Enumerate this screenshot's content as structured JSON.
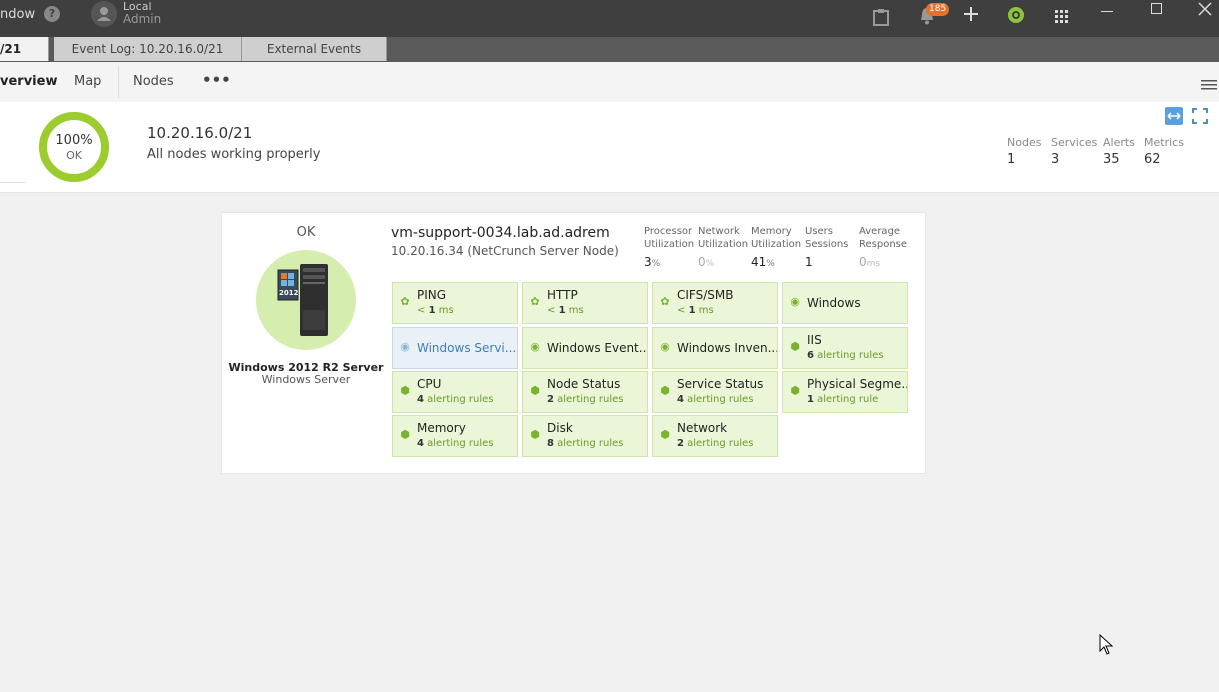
{
  "topbar": {
    "window_fragment": "ndow",
    "user_line1": "Local",
    "user_line2": "Admin",
    "notification_count": "185"
  },
  "tabs": [
    {
      "label": "/21"
    },
    {
      "label": "Event Log: 10.20.16.0/21"
    },
    {
      "label": "External Events"
    }
  ],
  "subnav": {
    "items": [
      "verview",
      "Map",
      "Nodes"
    ],
    "more": "•••"
  },
  "summary": {
    "percent": "100%",
    "percent_value": 100,
    "state": "OK",
    "network": "10.20.16.0/21",
    "message": "All nodes working properly",
    "stats": [
      {
        "label": "Nodes",
        "value": "1"
      },
      {
        "label": "Services",
        "value": "3"
      },
      {
        "label": "Alerts",
        "value": "35"
      },
      {
        "label": "Metrics",
        "value": "62"
      }
    ]
  },
  "node": {
    "status": "OK",
    "os_badge": "2012",
    "type": "Windows 2012 R2 Server",
    "subtype": "Windows Server",
    "hostname": "vm-support-0034.lab.ad.adrem",
    "address": "10.20.16.34 (NetCrunch Server Node)",
    "metrics": [
      {
        "label1": "Processor",
        "label2": "Utilization",
        "value": "3",
        "unit": "%"
      },
      {
        "label1": "Network",
        "label2": "Utilization",
        "value": "0",
        "unit": "%"
      },
      {
        "label1": "Memory",
        "label2": "Utilization",
        "value": "41",
        "unit": "%"
      },
      {
        "label1": "Users",
        "label2": "Sessions",
        "value": "1",
        "unit": ""
      },
      {
        "label1": "Average",
        "label2": "Response",
        "value": "0",
        "unit": "ms"
      }
    ],
    "tiles": [
      {
        "title": "PING",
        "pre": "< ",
        "num": "1",
        "post": " ms",
        "icon": "gear-icon"
      },
      {
        "title": "HTTP",
        "pre": "< ",
        "num": "1",
        "post": " ms",
        "icon": "gear-icon"
      },
      {
        "title": "CIFS/SMB",
        "pre": "< ",
        "num": "1",
        "post": " ms",
        "icon": "gear-icon"
      },
      {
        "title": "Windows",
        "icon": "eye-icon"
      },
      {
        "title": "Windows Servi...",
        "icon": "eye-icon"
      },
      {
        "title": "Windows Event...",
        "icon": "eye-icon"
      },
      {
        "title": "Windows Inven...",
        "icon": "eye-icon"
      },
      {
        "title": "IIS",
        "num": "6",
        "post": " alerting rules",
        "icon": "cube-icon"
      },
      {
        "title": "CPU",
        "num": "4",
        "post": " alerting rules",
        "icon": "cube-icon"
      },
      {
        "title": "Node Status",
        "num": "2",
        "post": " alerting rules",
        "icon": "cube-icon"
      },
      {
        "title": "Service Status",
        "num": "4",
        "post": " alerting rules",
        "icon": "cube-icon"
      },
      {
        "title": "Physical Segme...",
        "num": "1",
        "post": " alerting rule",
        "icon": "cube-icon"
      },
      {
        "title": "Memory",
        "num": "4",
        "post": " alerting rules",
        "icon": "cube-icon"
      },
      {
        "title": "Disk",
        "num": "8",
        "post": " alerting rules",
        "icon": "cube-icon"
      },
      {
        "title": "Network",
        "num": "2",
        "post": " alerting rules",
        "icon": "cube-icon"
      }
    ]
  },
  "colors": {
    "ok_green": "#9ccc2e",
    "tile_bg": "#eaf6d7",
    "accent_blue": "#3b7fb5",
    "badge_orange": "#e8702a"
  }
}
